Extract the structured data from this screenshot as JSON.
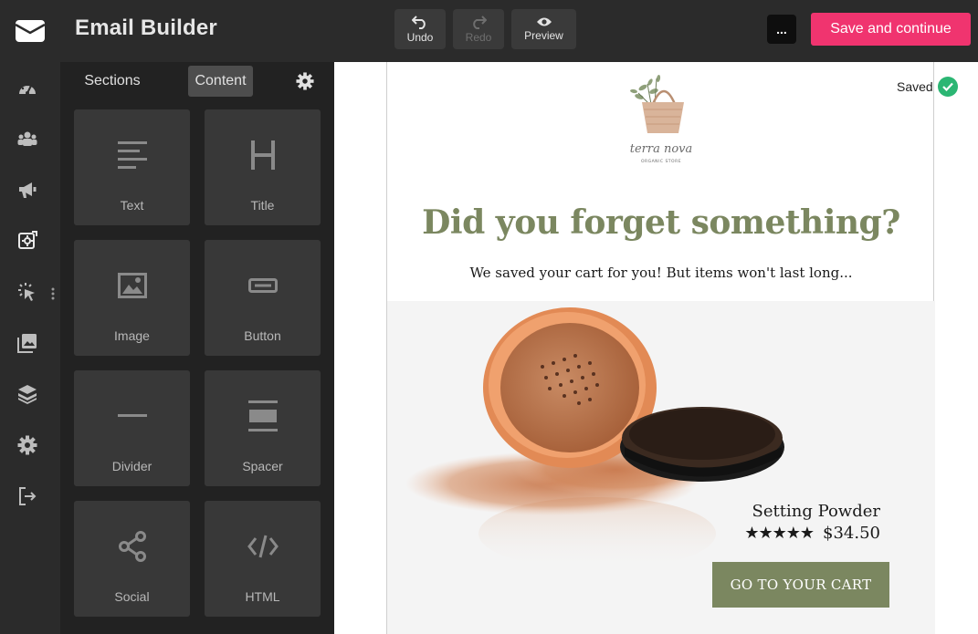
{
  "app": {
    "title": "Email Builder"
  },
  "toolbar": {
    "undo_label": "Undo",
    "redo_label": "Redo",
    "preview_label": "Preview",
    "more_label": "...",
    "save_label": "Save and continue"
  },
  "rail": {
    "items": [
      {
        "icon": "dashboard-icon"
      },
      {
        "icon": "contacts-icon"
      },
      {
        "icon": "campaigns-icon"
      },
      {
        "icon": "templates-icon"
      },
      {
        "icon": "automation-icon"
      },
      {
        "icon": "media-icon"
      },
      {
        "icon": "layers-icon"
      },
      {
        "icon": "settings-icon"
      },
      {
        "icon": "logout-icon"
      }
    ]
  },
  "panel": {
    "tabs": [
      {
        "label": "Sections",
        "active": false
      },
      {
        "label": "Content",
        "active": true
      }
    ],
    "blocks": [
      {
        "label": "Text",
        "icon": "text-icon"
      },
      {
        "label": "Title",
        "icon": "title-icon"
      },
      {
        "label": "Image",
        "icon": "image-icon"
      },
      {
        "label": "Button",
        "icon": "button-icon"
      },
      {
        "label": "Divider",
        "icon": "divider-icon"
      },
      {
        "label": "Spacer",
        "icon": "spacer-icon"
      },
      {
        "label": "Social",
        "icon": "share-icon"
      },
      {
        "label": "HTML",
        "icon": "code-icon"
      }
    ]
  },
  "status": {
    "saved_label": "Saved"
  },
  "email": {
    "brand_name": "terra nova",
    "brand_tagline": "ORGANIC STORE",
    "headline": "Did you forget something?",
    "subline": "We saved your cart for you! But items won't last long...",
    "product": {
      "name": "Setting Powder",
      "rating_stars": "★★★★★",
      "rating": 5,
      "price": "$34.50"
    },
    "cta_label": "GO TO YOUR CART"
  },
  "colors": {
    "topbar": "#2b2b2b",
    "panel": "#222222",
    "tile": "#383838",
    "accent_pink": "#f0346f",
    "olive": "#7b8760",
    "saved_green": "#2bb673"
  }
}
